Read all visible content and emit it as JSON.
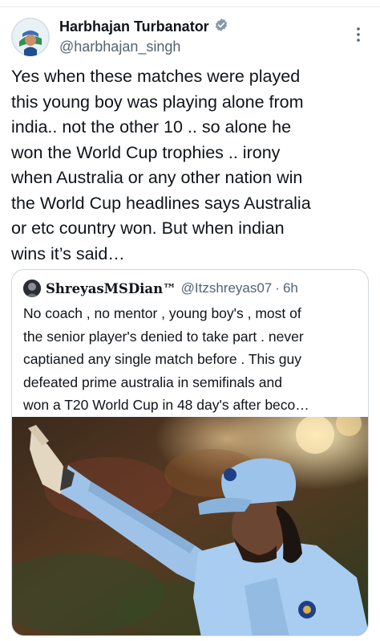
{
  "post": {
    "author": {
      "display_name": "Harbhajan Turbanator",
      "handle": "@harbhajan_singh",
      "verified": true
    },
    "text": "Yes when these matches were played\nthis young boy was playing alone from\nindia.. not the other 10 .. so alone he\nwon the World Cup trophies .. irony\nwhen Australia or any other nation win\nthe World Cup headlines says Australia\nor etc country won. But when indian\nwins it’s said…",
    "icons": {
      "more": "more-vertical-icon",
      "verified": "verified-badge-icon"
    },
    "colors": {
      "text": "#0f1419",
      "secondary": "#536471",
      "border": "#cfd9de",
      "verified": "#829aab"
    }
  },
  "quoted": {
    "display_name": "ShreyasMSDian™",
    "handle": "@Itzshreyas07",
    "separator": "·",
    "time": "6h",
    "text": "No coach , no mentor , young boy's  , most of\nthe senior player's denied to take part . never\ncaptianed any single match before . This guy\ndefeated prime australia in semifinals and\nwon a T20 World Cup in 48 day's after beco…",
    "media": "photo of cricketer in light blue jersey and cap pointing"
  }
}
